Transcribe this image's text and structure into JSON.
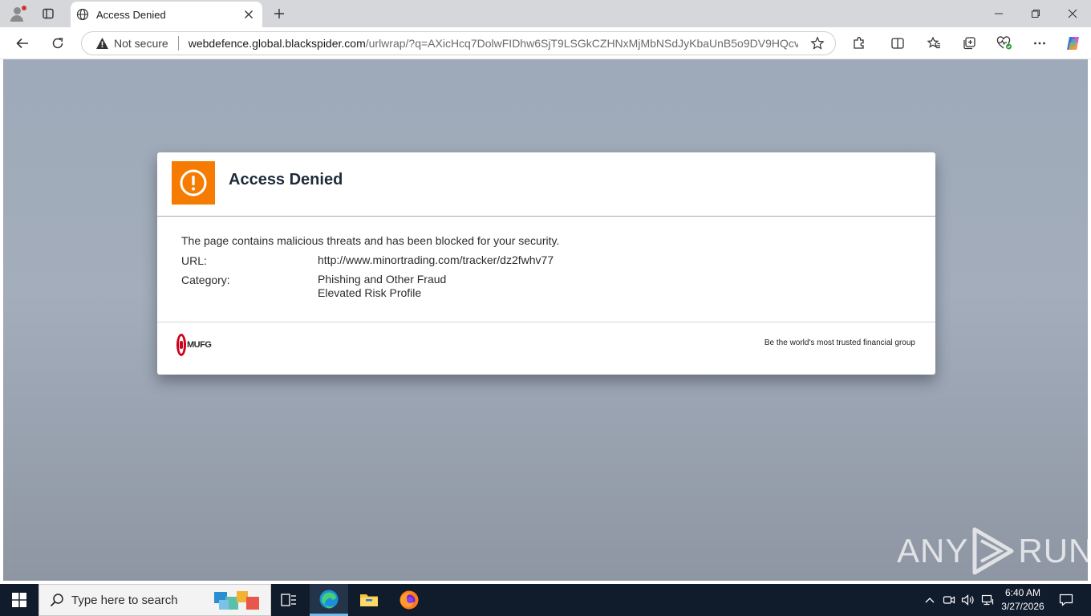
{
  "browser": {
    "tab": {
      "title": "Access Denied"
    },
    "address": {
      "security_label": "Not secure",
      "url_host": "webdefence.global.blackspider.com",
      "url_path": "/urlwrap/?q=AXicHcq7DolwFIDhw6SjT9LSGkCZHNxMjMbNSdJyKbaUnB5o9DV9HQcv..."
    }
  },
  "page": {
    "title": "Access Denied",
    "message": "The page contains malicious threats and has been blocked for your security.",
    "url_label": "URL:",
    "url_value": "http://www.minortrading.com/tracker/dz2fwhv77",
    "category_label": "Category:",
    "category_values": [
      "Phishing and Other Fraud",
      "Elevated Risk Profile"
    ],
    "logo_text": "MUFG",
    "tagline": "Be the world's most trusted financial group",
    "accent_color": "#f57c00"
  },
  "watermark": {
    "left": "ANY",
    "right": "RUN"
  },
  "taskbar": {
    "search_placeholder": "Type here to search",
    "time": "6:40 AM",
    "date": "3/27/2026"
  }
}
